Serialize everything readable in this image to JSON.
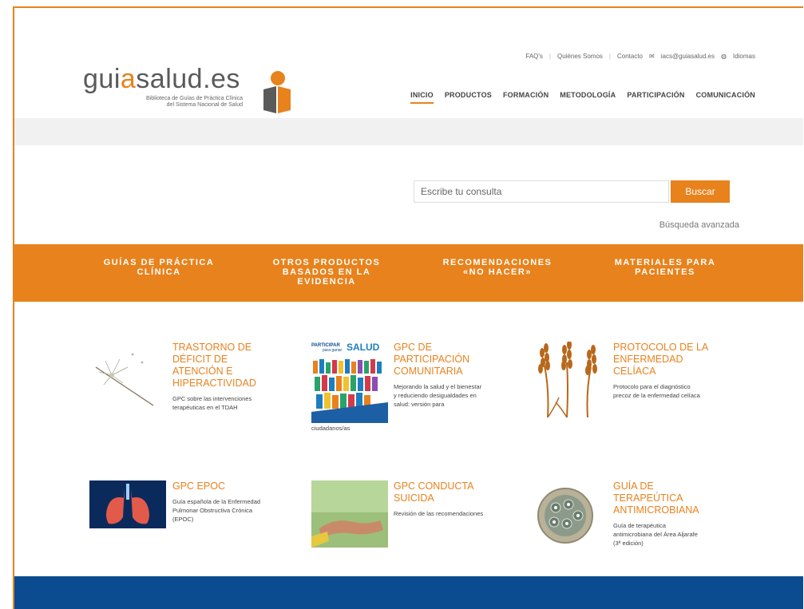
{
  "brand": {
    "name_part1": "gui",
    "name_accent": "a",
    "name_part2": "salud.es",
    "subtitle_line1": "Biblioteca de Guías de Práctica Clínica",
    "subtitle_line2": "del Sistema Nacional de Salud"
  },
  "toplinks": {
    "faqs": "FAQ's",
    "about": "Quiénes Somos",
    "contact": "Contacto",
    "email": "iacs@guiasalud.es",
    "languages": "Idiomas"
  },
  "nav": [
    "INICIO",
    "PRODUCTOS",
    "FORMACIÓN",
    "METODOLOGÍA",
    "PARTICIPACIÓN",
    "COMUNICACIÓN"
  ],
  "search": {
    "placeholder": "Escribe tu consulta",
    "button": "Buscar",
    "advanced": "Búsqueda avanzada"
  },
  "categories": [
    {
      "line1": "GUÍAS DE PRÁCTICA",
      "line2": "CLÍNICA",
      "line3": ""
    },
    {
      "line1": "OTROS PRODUCTOS",
      "line2": "BASADOS EN LA",
      "line3": "EVIDENCIA"
    },
    {
      "line1": "RECOMENDACIONES",
      "line2": "«NO HACER»",
      "line3": ""
    },
    {
      "line1": "MATERIALES PARA",
      "line2": "PACIENTES",
      "line3": ""
    }
  ],
  "cards": [
    {
      "title": [
        "TRASTORNO DE",
        "DÉFICIT DE",
        "ATENCIÓN E",
        "HIPERACTIVIDAD"
      ],
      "desc": [
        "GPC sobre las intervenciones",
        "terapéuticas en el TDAH"
      ]
    },
    {
      "title": [
        "GPC DE",
        "PARTICIPACIÓN",
        "COMUNITARIA"
      ],
      "desc": [
        "Mejorando la salud y el bienestar",
        "y reduciendo desigualdades en",
        "salud: versión para"
      ],
      "desc_overflow": "ciudadanos/as",
      "badge_top": "PARTICIPAR",
      "badge_sub": "para ganar",
      "badge_word": "SALUD"
    },
    {
      "title": [
        "PROTOCOLO DE LA",
        "ENFERMEDAD",
        "CELÍACA"
      ],
      "desc": [
        "Protocolo para el diagnóstico",
        "precoz de la enfermedad celíaca"
      ]
    },
    {
      "title": [
        "GPC EPOC"
      ],
      "desc": [
        "Guía española de la Enfermedad",
        "Pulmonar Obstructiva Crónica",
        "(EPOC)"
      ]
    },
    {
      "title": [
        "GPC CONDUCTA",
        "SUICIDA"
      ],
      "desc": [
        "Revisión de las recomendaciones"
      ]
    },
    {
      "title": [
        "GUÍA DE",
        "TERAPEÚTICA",
        "ANTIMICROBIANA"
      ],
      "desc": [
        "Guía de terapéutica",
        "antimicrobiana del Área Aljarafe",
        "(3ª edición)"
      ]
    }
  ],
  "colors": {
    "accent": "#e8821c",
    "footer": "#0b4b8f",
    "band": "#f1f1f1"
  },
  "icons": [
    "logo-mark-icon",
    "mail-icon",
    "globe-icon"
  ]
}
